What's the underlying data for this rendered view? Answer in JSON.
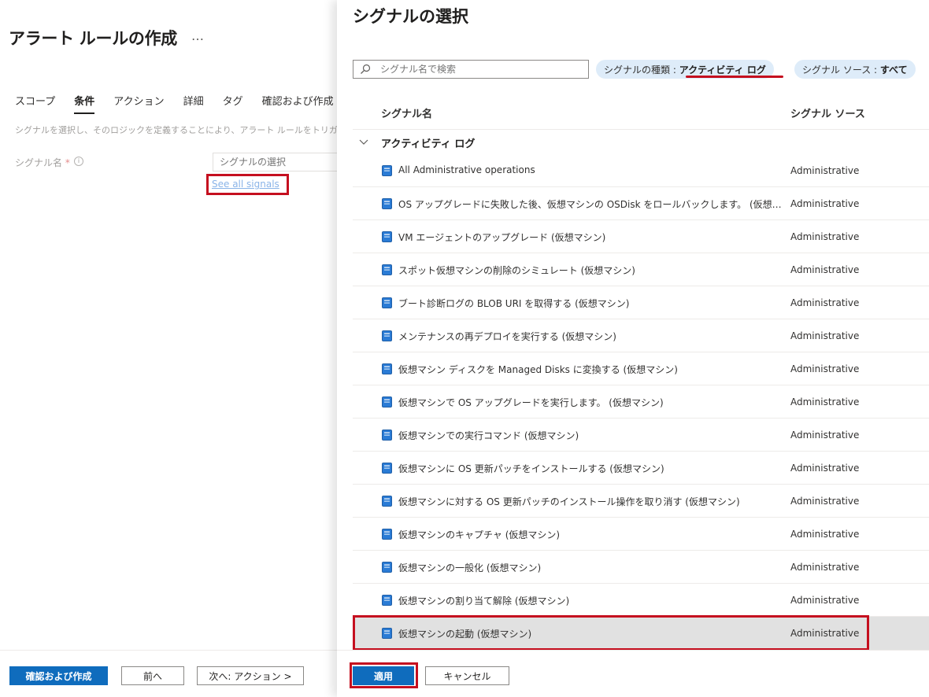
{
  "left_blade": {
    "title": "アラート ルールの作成",
    "more_label": "…",
    "tabs": [
      {
        "label": "スコープ",
        "active": false
      },
      {
        "label": "条件",
        "active": true
      },
      {
        "label": "アクション",
        "active": false
      },
      {
        "label": "詳細",
        "active": false
      },
      {
        "label": "タグ",
        "active": false
      },
      {
        "label": "確認および作成",
        "active": false
      }
    ],
    "description": "シグナルを選択し、そのロジックを定義することにより、アラート ルールをトリガーするタイミングを指定します。",
    "signal_field": {
      "label": "シグナル名",
      "required_mark": "*",
      "info_icon": "info-icon",
      "placeholder": "シグナルの選択"
    },
    "see_all_link": "See all signals",
    "footer": {
      "review_create": "確認および作成",
      "previous": "前へ",
      "next": "次へ: アクション >"
    }
  },
  "panel": {
    "title": "シグナルの選択",
    "search": {
      "placeholder": "シグナル名で検索",
      "icon": "search-icon"
    },
    "filters": {
      "signal_type_label": "シグナルの種類 : ",
      "signal_type_value": "アクティビティ ログ",
      "signal_source_label": "シグナル ソース : ",
      "signal_source_value": "すべて"
    },
    "columns": {
      "name": "シグナル名",
      "source": "シグナル ソース"
    },
    "group": {
      "label": "アクティビティ ログ",
      "expanded": true
    },
    "rows": [
      {
        "name": "All Administrative operations",
        "source": "Administrative"
      },
      {
        "name": "OS アップグレードに失敗した後、仮想マシンの OSDisk をロールバックします。 (仮想マシン)",
        "source": "Administrative"
      },
      {
        "name": "VM エージェントのアップグレード (仮想マシン)",
        "source": "Administrative"
      },
      {
        "name": "スポット仮想マシンの削除のシミュレート (仮想マシン)",
        "source": "Administrative"
      },
      {
        "name": "ブート診断ログの BLOB URI を取得する (仮想マシン)",
        "source": "Administrative"
      },
      {
        "name": "メンテナンスの再デプロイを実行する (仮想マシン)",
        "source": "Administrative"
      },
      {
        "name": "仮想マシン ディスクを Managed Disks に変換する (仮想マシン)",
        "source": "Administrative"
      },
      {
        "name": "仮想マシンで OS アップグレードを実行します。 (仮想マシン)",
        "source": "Administrative"
      },
      {
        "name": "仮想マシンでの実行コマンド (仮想マシン)",
        "source": "Administrative"
      },
      {
        "name": "仮想マシンに OS 更新パッチをインストールする (仮想マシン)",
        "source": "Administrative"
      },
      {
        "name": "仮想マシンに対する OS 更新パッチのインストール操作を取り消す (仮想マシン)",
        "source": "Administrative"
      },
      {
        "name": "仮想マシンのキャプチャ (仮想マシン)",
        "source": "Administrative"
      },
      {
        "name": "仮想マシンの一般化 (仮想マシン)",
        "source": "Administrative"
      },
      {
        "name": "仮想マシンの割り当て解除 (仮想マシン)",
        "source": "Administrative"
      },
      {
        "name": "仮想マシンの起動 (仮想マシン)",
        "source": "Administrative",
        "selected": true
      }
    ],
    "footer": {
      "apply": "適用",
      "cancel": "キャンセル"
    }
  },
  "colors": {
    "accent": "#0f6cbd",
    "highlight_red": "#c50f1f",
    "pill_bg": "#deecf9",
    "selected_row": "#e1e1e1"
  }
}
